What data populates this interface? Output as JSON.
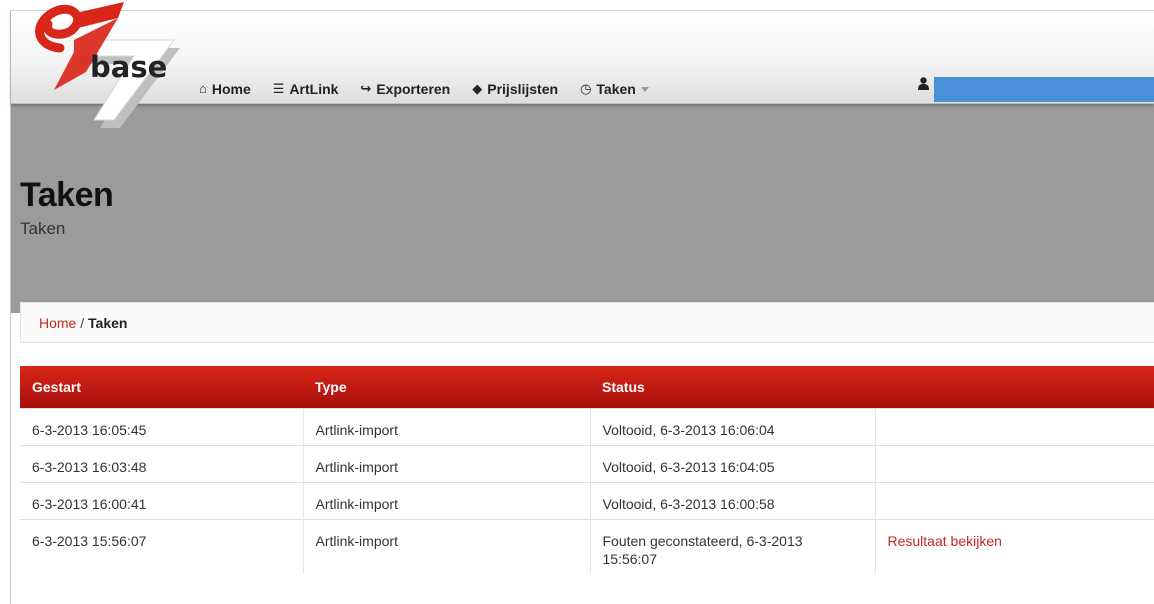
{
  "brand": {
    "logo_word": "base"
  },
  "nav": {
    "items": [
      {
        "label": "Home",
        "icon": "home-icon",
        "glyph": "⌂"
      },
      {
        "label": "ArtLink",
        "icon": "list-icon",
        "glyph": "☰"
      },
      {
        "label": "Exporteren",
        "icon": "export-icon",
        "glyph": "↪"
      },
      {
        "label": "Prijslijsten",
        "icon": "tags-icon",
        "glyph": "◆"
      },
      {
        "label": "Taken",
        "icon": "clock-icon",
        "glyph": "◷",
        "dropdown": true
      }
    ],
    "user_icon": "user-icon"
  },
  "header": {
    "title": "Taken",
    "subtitle": "Taken"
  },
  "breadcrumb": {
    "home": "Home",
    "separator": "/",
    "current": "Taken"
  },
  "table": {
    "columns": [
      "Gestart",
      "Type",
      "Status",
      ""
    ],
    "rows": [
      {
        "started": "6-3-2013 16:05:45",
        "type": "Artlink-import",
        "status": "Voltooid, 6-3-2013 16:06:04",
        "action": ""
      },
      {
        "started": "6-3-2013 16:03:48",
        "type": "Artlink-import",
        "status": "Voltooid, 6-3-2013 16:04:05",
        "action": ""
      },
      {
        "started": "6-3-2013 16:00:41",
        "type": "Artlink-import",
        "status": "Voltooid, 6-3-2013 16:00:58",
        "action": ""
      },
      {
        "started": "6-3-2013 15:56:07",
        "type": "Artlink-import",
        "status": "Fouten geconstateerd, 6-3-2013 15:56:07",
        "action": "Resultaat bekijken"
      }
    ]
  },
  "colors": {
    "accent_red": "#c8281e",
    "table_header_top": "#d9261a",
    "table_header_bottom": "#a80f0b",
    "hero_grey": "#9b9b9b",
    "user_bar_blue": "#4a90d9"
  }
}
